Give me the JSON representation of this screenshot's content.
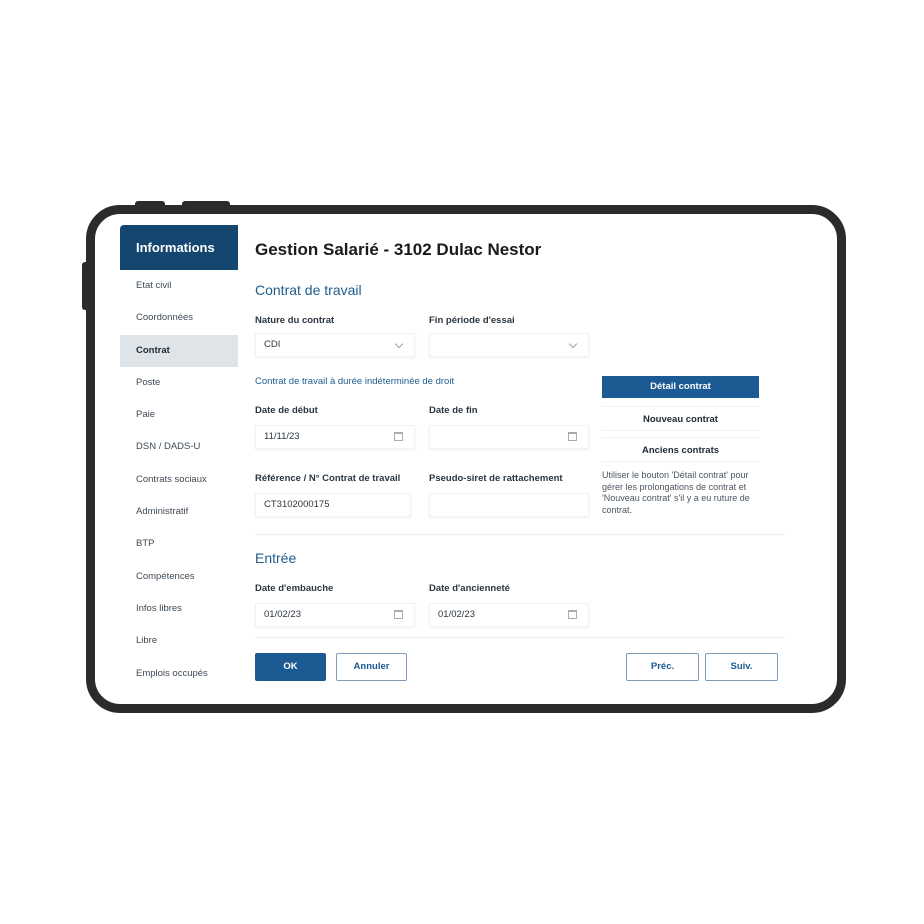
{
  "sidebar": {
    "header": "Informations",
    "items": [
      {
        "label": "Etat civil"
      },
      {
        "label": "Coordonnées"
      },
      {
        "label": "Contrat"
      },
      {
        "label": "Poste"
      },
      {
        "label": "Paie"
      },
      {
        "label": "DSN / DADS-U"
      },
      {
        "label": "Contrats sociaux"
      },
      {
        "label": "Administratif"
      },
      {
        "label": "BTP"
      },
      {
        "label": "Compétences"
      },
      {
        "label": "Infos libres"
      },
      {
        "label": "Libre"
      },
      {
        "label": "Emplois occupés"
      }
    ],
    "active_index": 2
  },
  "main": {
    "title": "Gestion Salarié - 3102 Dulac Nestor",
    "contract_section": {
      "heading": "Contrat de travail",
      "nature_label": "Nature du contrat",
      "nature_value": "CDI",
      "trial_end_label": "Fin période d'essai",
      "trial_end_value": "",
      "description": "Contrat de travail à durée indéterminée de droit",
      "start_date_label": "Date de début",
      "start_date_value": "11/11/23",
      "end_date_label": "Date de fin",
      "end_date_value": "",
      "reference_label": "Référence / N° Contrat de travail",
      "reference_value": "CT3102000175",
      "pseudo_siret_label": "Pseudo-siret de rattachement",
      "pseudo_siret_value": "",
      "detail_button": "Détail contrat",
      "new_button": "Nouveau contrat",
      "old_button": "Anciens contrats",
      "help_text": "Utiliser le bouton 'Détail contrat' pour gérer les prolongations de contrat et 'Nouveau contrat' s'il y a eu ruture de contrat."
    },
    "entry_section": {
      "heading": "Entrée",
      "hire_date_label": "Date d'embauche",
      "hire_date_value": "01/02/23",
      "seniority_date_label": "Date d'ancienneté",
      "seniority_date_value": "01/02/23"
    },
    "footer": {
      "ok": "OK",
      "cancel": "Annuler",
      "prev": "Préc.",
      "next": "Suiv."
    }
  },
  "colors": {
    "brand": "#154670",
    "accent": "#1b5a92",
    "active_item_bg": "#dfe4e9"
  }
}
